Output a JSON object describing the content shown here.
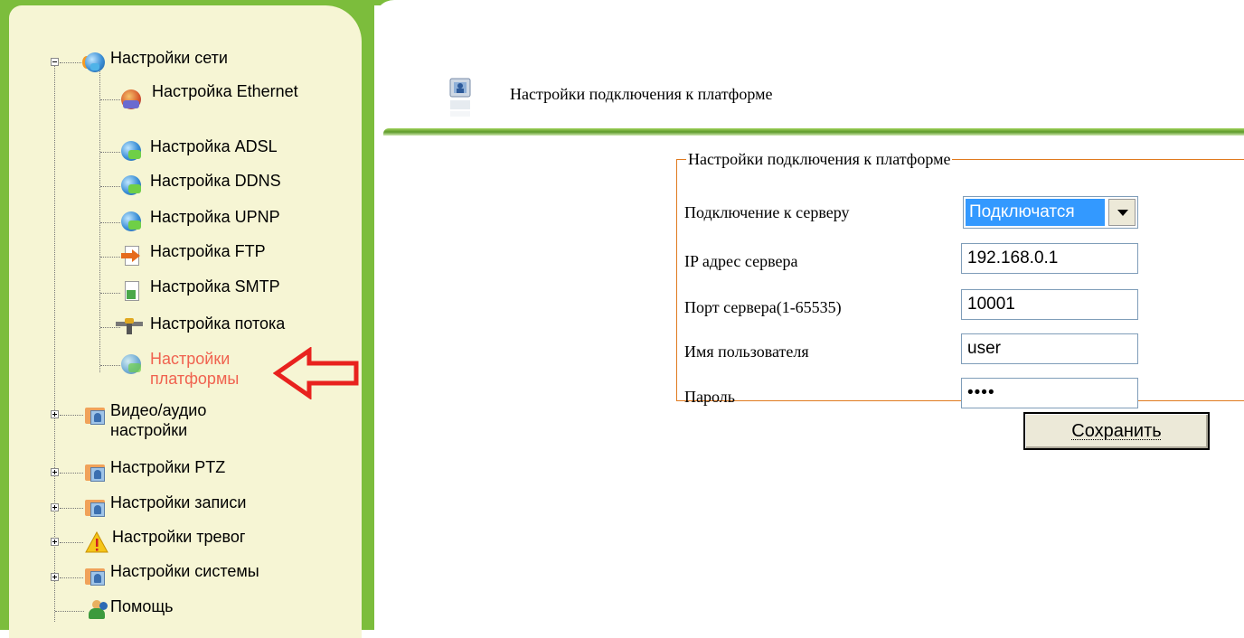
{
  "sidebar": {
    "items": [
      {
        "label": "Настройки сети",
        "icon": "network-globe-icon",
        "expanded": true
      },
      {
        "label": "Настройка Ethernet",
        "icon": "ethernet-icon"
      },
      {
        "label": "Настройка ADSL",
        "icon": "globe-icon"
      },
      {
        "label": "Настройка DDNS",
        "icon": "globe-icon"
      },
      {
        "label": "Настройка UPNP",
        "icon": "globe-icon"
      },
      {
        "label": "Настройка FTP",
        "icon": "ftp-arrow-icon"
      },
      {
        "label": "Настройка SMTP",
        "icon": "smtp-icon"
      },
      {
        "label": "Настройка потока",
        "icon": "stream-icon"
      },
      {
        "label": "Настройки платформы",
        "icon": "globe-icon",
        "active": true
      },
      {
        "label": "Видео/аудио настройки",
        "icon": "folder-icon"
      },
      {
        "label": "Настройки PTZ",
        "icon": "folder-icon"
      },
      {
        "label": "Настройки записи",
        "icon": "folder-icon"
      },
      {
        "label": "Настройки тревог",
        "icon": "warning-icon"
      },
      {
        "label": "Настройки системы",
        "icon": "folder-icon"
      },
      {
        "label": "Помощь",
        "icon": "help-icon"
      }
    ]
  },
  "main": {
    "title": "Настройки подключения к платформе",
    "fieldset_legend": "Настройки подключения к платформе",
    "fields": {
      "connection": {
        "label": "Подключение к серверу",
        "value": "Подключатся"
      },
      "ip": {
        "label": "IP адрес сервера",
        "value": "192.168.0.1"
      },
      "port": {
        "label": "Порт сервера(1-65535)",
        "value": "10001"
      },
      "user": {
        "label": "Имя пользователя",
        "value": "user"
      },
      "password": {
        "label": "Пароль",
        "value": "••••"
      }
    },
    "save_label": "Сохранить"
  },
  "colors": {
    "accent_green": "#7cbd3c",
    "panel_bg": "#f6f5d4",
    "active_text": "#f0624f",
    "fieldset_border": "#e07a1f",
    "annotation_arrow": "#e8221e"
  }
}
